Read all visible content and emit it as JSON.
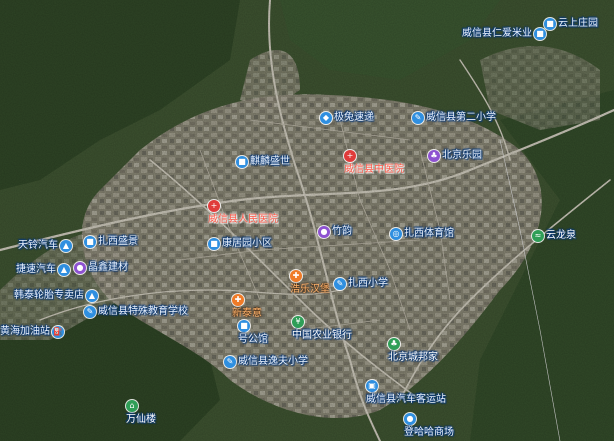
{
  "pois": [
    {
      "key": "yunshang",
      "label": "云上庄园",
      "color": "#2f8fe0",
      "cls": "blue",
      "icon": "building"
    },
    {
      "key": "renai",
      "label": "威信县仁爱米业",
      "color": "#2f8fe0",
      "cls": "blue",
      "icon": "building"
    },
    {
      "key": "ji",
      "label": "极兔速递",
      "color": "#2f8fe0",
      "cls": "blue",
      "icon": "box"
    },
    {
      "key": "xiaoxue2",
      "label": "威信县第二小学",
      "color": "#2f8fe0",
      "cls": "blue",
      "icon": "school"
    },
    {
      "key": "qilin",
      "label": "麒麟盛世",
      "color": "#2f8fe0",
      "cls": "blue",
      "icon": "building"
    },
    {
      "key": "renmin",
      "label": "威信县人民医院",
      "color": "#e03b3b",
      "cls": "red",
      "icon": "hospital"
    },
    {
      "key": "jingxi",
      "label": "北京乐园",
      "color": "#8e52d1",
      "cls": "blue",
      "icon": "park"
    },
    {
      "key": "zhongyi",
      "label": "威信县中医院",
      "color": "#e03b3b",
      "cls": "red",
      "icon": "hospital"
    },
    {
      "key": "tianling",
      "label": "天铃汽车",
      "color": "#2f8fe0",
      "cls": "blue",
      "icon": "car"
    },
    {
      "key": "zaxi",
      "label": "扎西盛景",
      "color": "#2f8fe0",
      "cls": "blue",
      "icon": "building"
    },
    {
      "key": "kangju",
      "label": "康居园小区",
      "color": "#2f8fe0",
      "cls": "blue",
      "icon": "building"
    },
    {
      "key": "zhuyu",
      "label": "竹韵",
      "color": "#8e52d1",
      "cls": "blue",
      "icon": "shop"
    },
    {
      "key": "tiyuguan",
      "label": "扎西体育馆",
      "color": "#2f8fe0",
      "cls": "blue",
      "icon": "sport"
    },
    {
      "key": "yunlong",
      "label": "云龙泉",
      "color": "#2f9e57",
      "cls": "green",
      "icon": "spring"
    },
    {
      "key": "jiesu",
      "label": "捷速汽车",
      "color": "#2f8fe0",
      "cls": "blue",
      "icon": "car"
    },
    {
      "key": "jiancai",
      "label": "晶鑫建材",
      "color": "#8e52d1",
      "cls": "blue",
      "icon": "shop"
    },
    {
      "key": "zhaxixiao",
      "label": "扎西小学",
      "color": "#2f8fe0",
      "cls": "blue",
      "icon": "school"
    },
    {
      "key": "haole",
      "label": "浩乐汉堡",
      "color": "#f07b27",
      "cls": "orange",
      "icon": "food"
    },
    {
      "key": "luntai",
      "label": "韩泰轮胎专卖店",
      "color": "#2f8fe0",
      "cls": "blue",
      "icon": "car"
    },
    {
      "key": "tejiao",
      "label": "威信县特殊教育学校",
      "color": "#2f8fe0",
      "cls": "blue",
      "icon": "school"
    },
    {
      "key": "xinglu",
      "label": "新泰意",
      "color": "#f07b27",
      "cls": "orange",
      "icon": "food"
    },
    {
      "key": "jiayou",
      "label": "黄海加油站",
      "color": "#2f8fe0",
      "cls": "blue",
      "icon": "fuel"
    },
    {
      "key": "wangong",
      "label": "号公馆",
      "color": "#2f8fe0",
      "cls": "blue",
      "icon": "building"
    },
    {
      "key": "guangchang",
      "label": "中国农业银行",
      "color": "#2f9e57",
      "cls": "green",
      "icon": "bank"
    },
    {
      "key": "beijing",
      "label": "北京城邦家",
      "color": "#2f9e57",
      "cls": "green",
      "icon": "park"
    },
    {
      "key": "xiaotian",
      "label": "威信县逸夫小学",
      "color": "#2f8fe0",
      "cls": "blue",
      "icon": "school"
    },
    {
      "key": "qiche",
      "label": "威信县汽车客运站",
      "color": "#2f8fe0",
      "cls": "blue",
      "icon": "bus"
    },
    {
      "key": "wanxian",
      "label": "万仙楼",
      "color": "#2f9e57",
      "cls": "green",
      "icon": "temple"
    },
    {
      "key": "dengha",
      "label": "登哈哈商场",
      "color": "#2f8fe0",
      "cls": "blue",
      "icon": "shop"
    }
  ],
  "icons": {
    "building": "■",
    "box": "◆",
    "school": "✎",
    "hospital": "+",
    "park": "♣",
    "car": "▲",
    "shop": "●",
    "sport": "◎",
    "spring": "≈",
    "food": "✚",
    "fuel": "⛽",
    "bank": "¥",
    "bus": "▣",
    "temple": "⌂"
  }
}
